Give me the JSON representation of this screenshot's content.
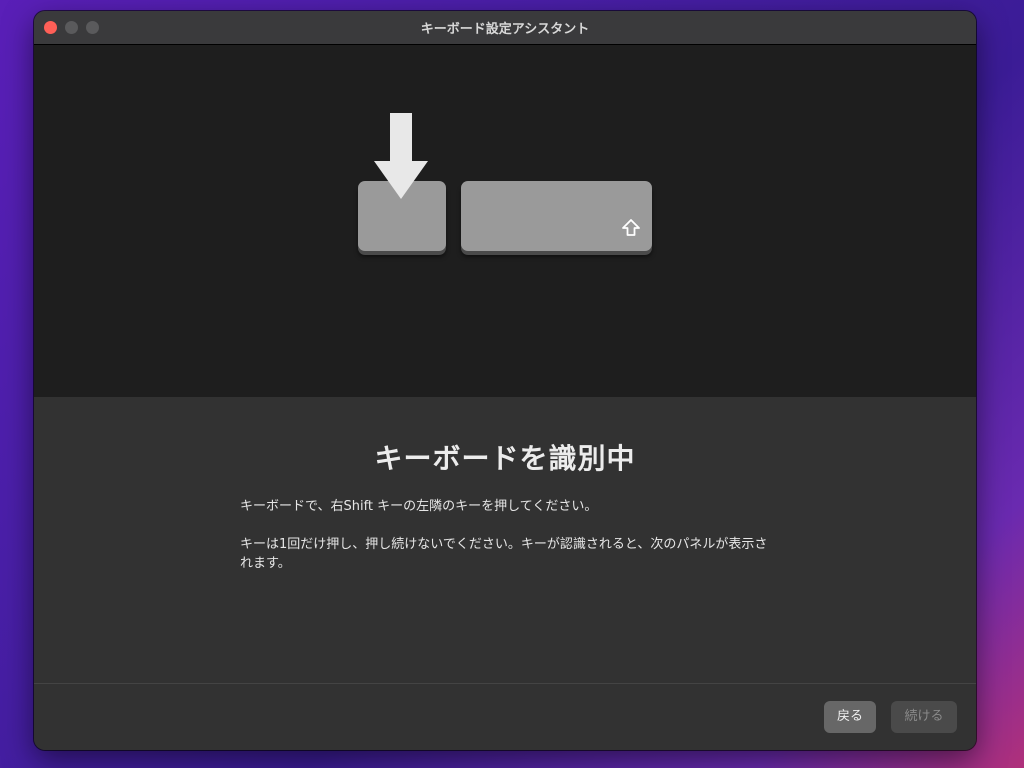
{
  "window": {
    "title": "キーボード設定アシスタント"
  },
  "illustration": {
    "pressed_key_indicator": "down-arrow-icon",
    "wide_key_symbol": "shift-arrow-icon"
  },
  "content": {
    "heading": "キーボードを識別中",
    "paragraph1": "キーボードで、右Shift キーの左隣のキーを押してください。",
    "paragraph2": "キーは1回だけ押し、押し続けないでください。キーが認識されると、次のパネルが表示されます。"
  },
  "footer": {
    "back_label": "戻る",
    "continue_label": "続ける"
  },
  "colors": {
    "close_button": "#fe5f57",
    "key_fill": "#9a9a9a",
    "illustration_bg": "#1e1e1e",
    "panel_bg": "#323232"
  }
}
